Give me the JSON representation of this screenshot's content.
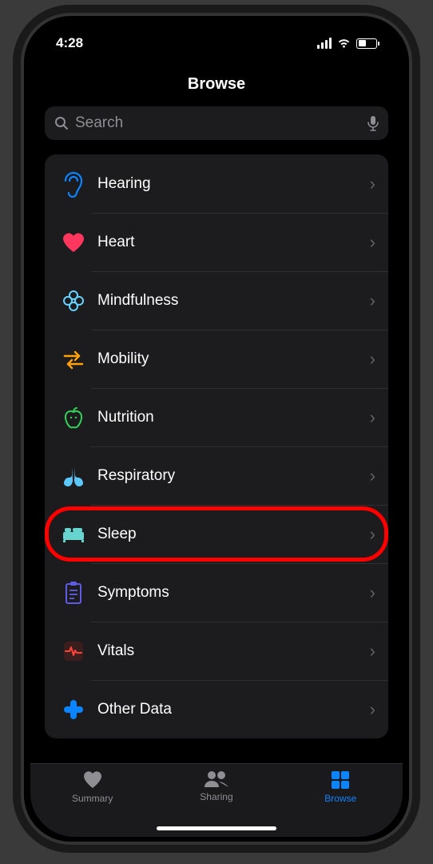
{
  "status": {
    "time": "4:28"
  },
  "header": {
    "title": "Browse"
  },
  "search": {
    "placeholder": "Search"
  },
  "categories": [
    {
      "label": "Hearing",
      "icon": "hearing-icon",
      "color": "#0a84ff"
    },
    {
      "label": "Heart",
      "icon": "heart-icon",
      "color": "#ff375f"
    },
    {
      "label": "Mindfulness",
      "icon": "mindfulness-icon",
      "color": "#64d2ff"
    },
    {
      "label": "Mobility",
      "icon": "mobility-icon",
      "color": "#ff9f0a"
    },
    {
      "label": "Nutrition",
      "icon": "nutrition-icon",
      "color": "#30d158"
    },
    {
      "label": "Respiratory",
      "icon": "respiratory-icon",
      "color": "#5ac8fa"
    },
    {
      "label": "Sleep",
      "icon": "sleep-icon",
      "color": "#66d4cf",
      "highlighted": true
    },
    {
      "label": "Symptoms",
      "icon": "symptoms-icon",
      "color": "#5e5ce6"
    },
    {
      "label": "Vitals",
      "icon": "vitals-icon",
      "color": "#ff453a"
    },
    {
      "label": "Other Data",
      "icon": "other-data-icon",
      "color": "#0a84ff"
    }
  ],
  "tabs": {
    "summary": "Summary",
    "sharing": "Sharing",
    "browse": "Browse",
    "active": "browse"
  }
}
